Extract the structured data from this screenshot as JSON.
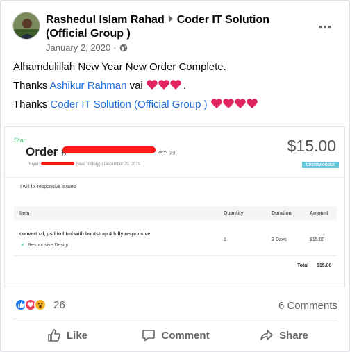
{
  "post": {
    "author": "Rashedul Islam Rahad",
    "group": "Coder IT Solution (Official Group )",
    "date": "January 2, 2020",
    "dot": "·",
    "line1": "Alhamdulillah New Year New Order Complete.",
    "line2_prefix": "Thanks ",
    "line2_link": "Ashikur Rahman",
    "line2_suffix": " vai",
    "line2_end": ".",
    "line3_prefix": "Thanks ",
    "line3_link": "Coder IT Solution (Official Group )"
  },
  "attachment": {
    "star": "Star",
    "order_label": "Order #",
    "view_gig": "view gig",
    "buyer_label": "Buyer:",
    "view_history": "(view history)",
    "separator": "|",
    "order_date": "December 29, 2019",
    "price": "$15.00",
    "badge": "CUSTOM ORDER",
    "description": "I will fix responsive issues",
    "table": {
      "headers": {
        "item": "Item",
        "quantity": "Quantity",
        "duration": "Duration",
        "amount": "Amount"
      },
      "row": {
        "item": "convert xd, psd to html with bootstrap 4 fully responsive",
        "sub": "Responsive Design",
        "quantity": "1",
        "duration": "3 Days",
        "amount": "$15.00"
      },
      "total_label": "Total",
      "total_value": "$15.00"
    }
  },
  "engagement": {
    "reaction_count": "26",
    "comments": "6 Comments",
    "like": "Like",
    "comment": "Comment",
    "share": "Share"
  },
  "colors": {
    "link": "#216fdb",
    "like": "#1877f2",
    "love": "#f33e58",
    "wow": "#f7b125",
    "redaction": "#ff1a1a"
  }
}
